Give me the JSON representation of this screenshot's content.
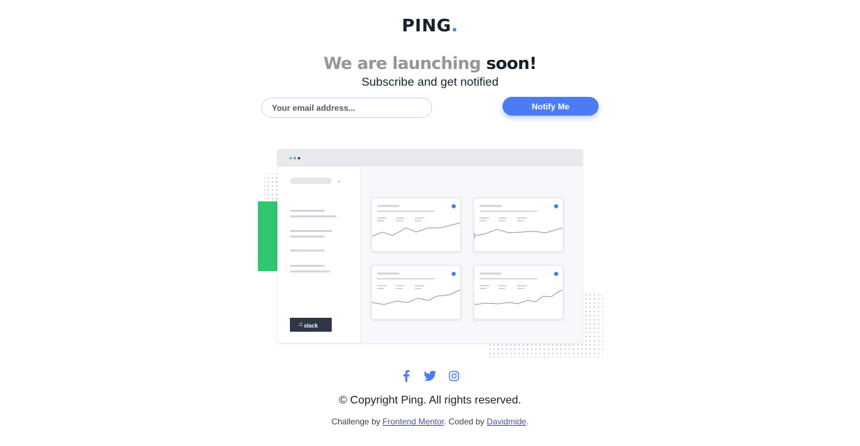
{
  "header": {
    "logo_text": "PING",
    "logo_dot": "."
  },
  "hero": {
    "headline_light": "We are launching",
    "headline_dark": "soon!",
    "subtitle": "Subscribe and get notified"
  },
  "form": {
    "email_placeholder": "Your email address...",
    "email_value": "",
    "submit_label": "Notify Me"
  },
  "illustration": {
    "slack_label": "slack"
  },
  "socials": [
    {
      "name": "facebook-icon"
    },
    {
      "name": "twitter-icon"
    },
    {
      "name": "instagram-icon"
    }
  ],
  "footer": {
    "copyright": "© Copyright Ping. All rights reserved.",
    "attribution_prefix": "Challenge by ",
    "link_frontend_mentor": "Frontend Mentor",
    "attribution_middle": ". Coded by ",
    "link_author": "Davidmide",
    "attribution_suffix": "."
  },
  "colors": {
    "accent_blue": "#4c7bf3",
    "dark_blue": "#15202a",
    "gray": "#969696",
    "green": "#2ec66f"
  }
}
